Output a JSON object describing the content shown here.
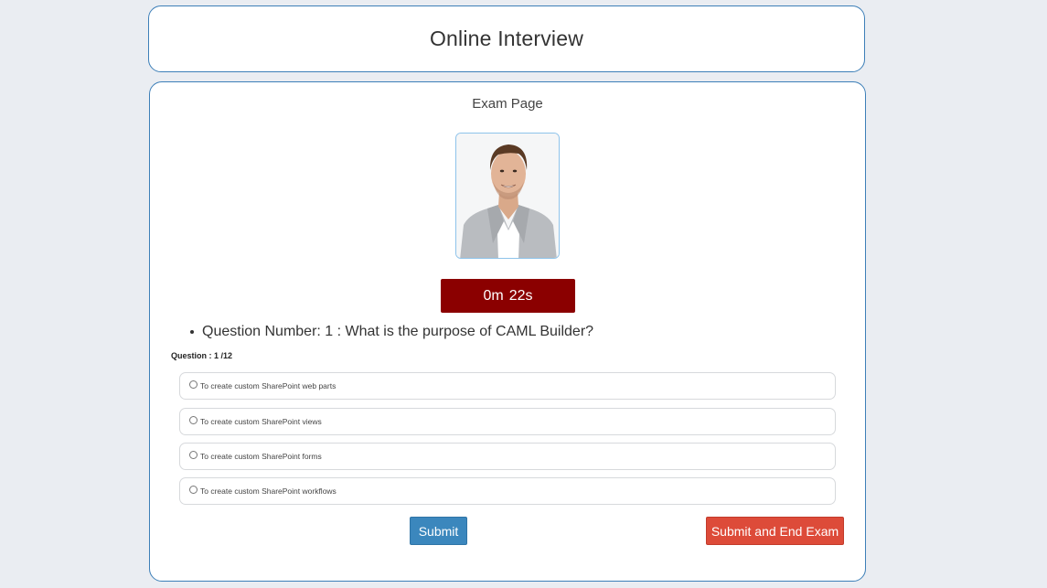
{
  "header": {
    "title": "Online Interview"
  },
  "exam": {
    "page_title": "Exam Page",
    "timer": {
      "minutes": "0m",
      "seconds": "22s"
    },
    "question": {
      "text": "Question Number: 1 : What is the purpose of CAML Builder?",
      "counter": "Question : 1 /12"
    },
    "options": [
      {
        "label": "To create custom SharePoint web parts",
        "selected": false
      },
      {
        "label": "To create custom SharePoint views",
        "selected": false
      },
      {
        "label": "To create custom SharePoint forms",
        "selected": false
      },
      {
        "label": "To create custom SharePoint workflows",
        "selected": false
      }
    ],
    "buttons": {
      "submit": "Submit",
      "submit_end": "Submit and End Exam"
    }
  },
  "colors": {
    "timer_bg": "#8b0000",
    "submit_bg": "#3b87bd",
    "end_bg": "#dd4b39",
    "card_border": "#3d7fb8"
  }
}
